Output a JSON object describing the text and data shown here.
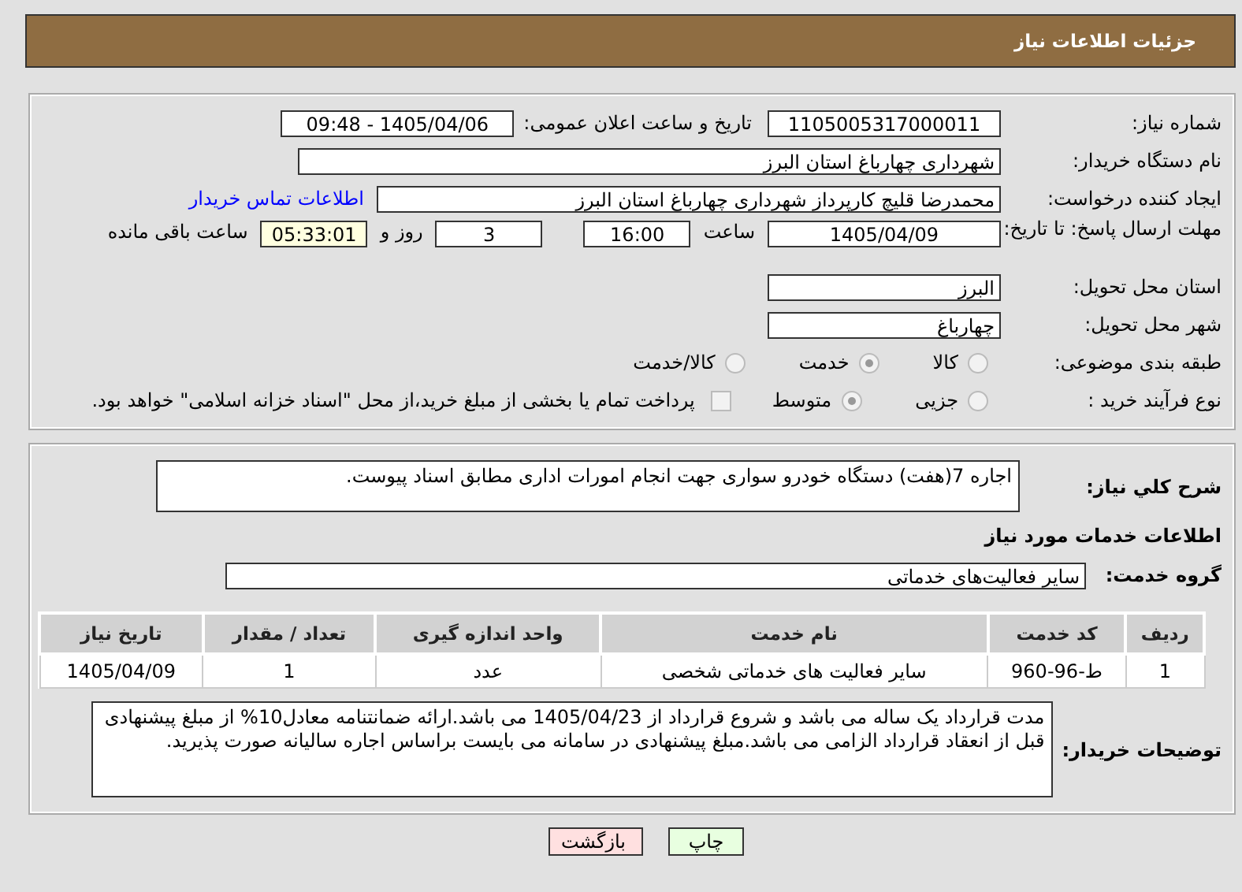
{
  "header": {
    "title": "جزئیات اطلاعات نیاز"
  },
  "need_number": {
    "label": "شماره نیاز:",
    "value": "1105005317000011"
  },
  "announce": {
    "label": "تاریخ و ساعت اعلان عمومی:",
    "value": "1405/04/06 - 09:48"
  },
  "buyer": {
    "label": "نام دستگاه خریدار:",
    "value": "شهرداری چهارباغ استان البرز"
  },
  "requester": {
    "label": "ایجاد کننده درخواست:",
    "value": "محمدرضا قلیچ کارپرداز شهرداری چهارباغ استان البرز",
    "link": "اطلاعات تماس خریدار"
  },
  "deadline": {
    "label": "مهلت ارسال پاسخ: تا تاریخ:",
    "date": "1405/04/09",
    "time_label": "ساعت",
    "time": "16:00",
    "days": "3",
    "days_label": "روز و",
    "remaining": "05:33:01",
    "remaining_label": "ساعت باقی مانده"
  },
  "province": {
    "label": "استان محل تحویل:",
    "value": "البرز"
  },
  "city": {
    "label": "شهر محل تحویل:",
    "value": "چهارباغ"
  },
  "category": {
    "label": "طبقه بندی موضوعی:",
    "options": [
      {
        "label": "کالا",
        "selected": false
      },
      {
        "label": "خدمت",
        "selected": true
      },
      {
        "label": "کالا/خدمت",
        "selected": false
      }
    ]
  },
  "process": {
    "label": "نوع فرآیند خرید :",
    "options": [
      {
        "label": "جزیی",
        "selected": false
      },
      {
        "label": "متوسط",
        "selected": true
      }
    ],
    "payment": {
      "label": "پرداخت تمام یا بخشی از مبلغ خرید،از محل \"اسناد خزانه اسلامی\" خواهد بود.",
      "checked": false
    }
  },
  "description": {
    "label": "شرح کلي نياز:",
    "value": "اجاره 7(هفت) دستگاه خودرو سواری جهت انجام امورات اداری مطابق اسناد پیوست."
  },
  "services_title": "اطلاعات خدمات مورد نیاز",
  "service_group": {
    "label": "گروه خدمت:",
    "value": "سایر فعالیت‌های خدماتی"
  },
  "table": {
    "columns": [
      "ردیف",
      "کد خدمت",
      "نام خدمت",
      "واحد اندازه گیری",
      "تعداد / مقدار",
      "تاریخ نیاز"
    ],
    "rows": [
      [
        "1",
        "ط-96-960",
        "سایر فعالیت های خدماتی شخصی",
        "عدد",
        "1",
        "1405/04/09"
      ]
    ]
  },
  "buyer_notes": {
    "label": "توضیحات خریدار:",
    "value": "مدت قرارداد یک ساله می باشد و شروع قرارداد از 1405/04/23 می باشد.ارائه ضمانتنامه معادل10% از مبلغ پیشنهادی قبل از انعقاد قرارداد الزامی می باشد.مبلغ پیشنهادی در سامانه می بایست براساس اجاره سالیانه صورت پذیرید."
  },
  "buttons": [
    {
      "label": "چاپ",
      "kind": "print"
    },
    {
      "label": "بازگشت",
      "kind": "back"
    }
  ]
}
